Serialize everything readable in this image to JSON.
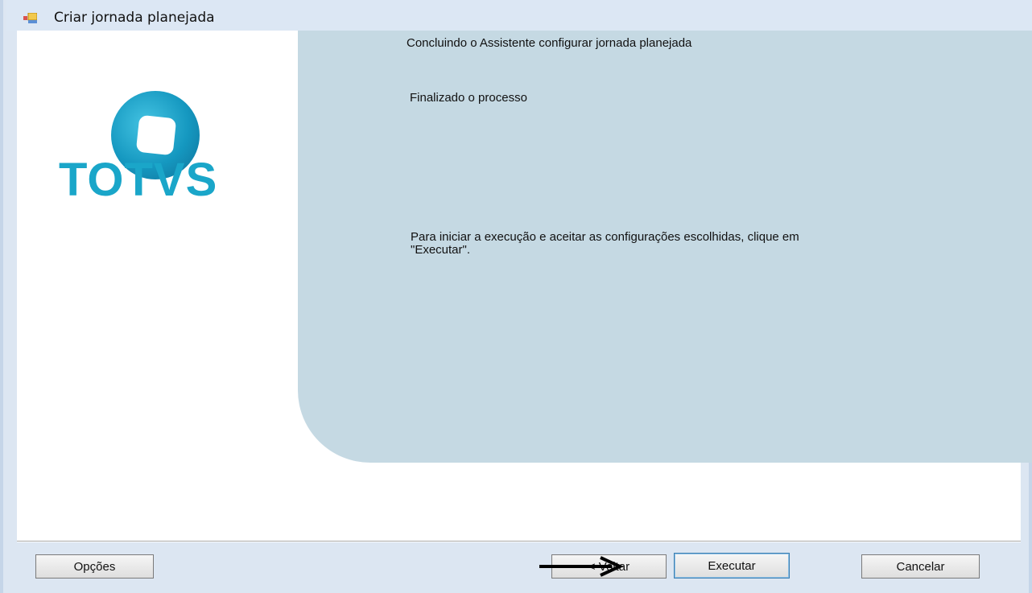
{
  "window": {
    "title": "Criar jornada planejada"
  },
  "logo": {
    "brand": "TOTVS",
    "color": "#1aa6c9"
  },
  "content": {
    "heading": "Concluindo o Assistente configurar jornada planejada",
    "status": "Finalizado o processo",
    "instructions": "Para iniciar a execução e aceitar as configurações escolhidas, clique em \"Executar\"."
  },
  "buttons": {
    "options_label": "Opções",
    "back_label": "< Voltar",
    "execute_label": "Executar",
    "cancel_label": "Cancelar"
  },
  "annotation": {
    "icon": "arrow-right-icon"
  },
  "colors": {
    "panel": "#c5d9e3",
    "titlebar": "#dce7f4"
  }
}
